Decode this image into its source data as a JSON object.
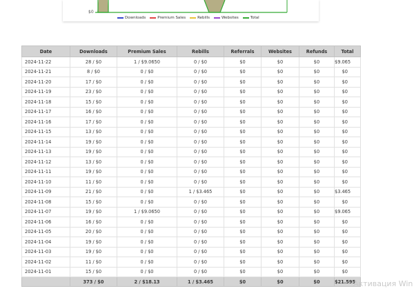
{
  "chart": {
    "y_zero_label": "$0",
    "legend": [
      {
        "label": "Downloads",
        "color": "#3344cc"
      },
      {
        "label": "Premium Sales",
        "color": "#e04444"
      },
      {
        "label": "Rebills",
        "color": "#e8c23a"
      },
      {
        "label": "Websites",
        "color": "#9944cc"
      },
      {
        "label": "Total",
        "color": "#33aa33"
      }
    ]
  },
  "table": {
    "headers": [
      "Date",
      "Downloads",
      "Premium Sales",
      "Rebills",
      "Referrals",
      "Websites",
      "Refunds",
      "Total"
    ],
    "rows": [
      [
        "2024-11-22",
        "28 / $0",
        "1 / $9.0650",
        "0 / $0",
        "$0",
        "$0",
        "$0",
        "$9.065"
      ],
      [
        "2024-11-21",
        "8 / $0",
        "0 / $0",
        "0 / $0",
        "$0",
        "$0",
        "$0",
        "$0"
      ],
      [
        "2024-11-20",
        "17 / $0",
        "0 / $0",
        "0 / $0",
        "$0",
        "$0",
        "$0",
        "$0"
      ],
      [
        "2024-11-19",
        "23 / $0",
        "0 / $0",
        "0 / $0",
        "$0",
        "$0",
        "$0",
        "$0"
      ],
      [
        "2024-11-18",
        "15 / $0",
        "0 / $0",
        "0 / $0",
        "$0",
        "$0",
        "$0",
        "$0"
      ],
      [
        "2024-11-17",
        "16 / $0",
        "0 / $0",
        "0 / $0",
        "$0",
        "$0",
        "$0",
        "$0"
      ],
      [
        "2024-11-16",
        "17 / $0",
        "0 / $0",
        "0 / $0",
        "$0",
        "$0",
        "$0",
        "$0"
      ],
      [
        "2024-11-15",
        "13 / $0",
        "0 / $0",
        "0 / $0",
        "$0",
        "$0",
        "$0",
        "$0"
      ],
      [
        "2024-11-14",
        "19 / $0",
        "0 / $0",
        "0 / $0",
        "$0",
        "$0",
        "$0",
        "$0"
      ],
      [
        "2024-11-13",
        "19 / $0",
        "0 / $0",
        "0 / $0",
        "$0",
        "$0",
        "$0",
        "$0"
      ],
      [
        "2024-11-12",
        "13 / $0",
        "0 / $0",
        "0 / $0",
        "$0",
        "$0",
        "$0",
        "$0"
      ],
      [
        "2024-11-11",
        "19 / $0",
        "0 / $0",
        "0 / $0",
        "$0",
        "$0",
        "$0",
        "$0"
      ],
      [
        "2024-11-10",
        "11 / $0",
        "0 / $0",
        "0 / $0",
        "$0",
        "$0",
        "$0",
        "$0"
      ],
      [
        "2024-11-09",
        "21 / $0",
        "0 / $0",
        "1 / $3.465",
        "$0",
        "$0",
        "$0",
        "$3.465"
      ],
      [
        "2024-11-08",
        "15 / $0",
        "0 / $0",
        "0 / $0",
        "$0",
        "$0",
        "$0",
        "$0"
      ],
      [
        "2024-11-07",
        "19 / $0",
        "1 / $9.0650",
        "0 / $0",
        "$0",
        "$0",
        "$0",
        "$9.065"
      ],
      [
        "2024-11-06",
        "16 / $0",
        "0 / $0",
        "0 / $0",
        "$0",
        "$0",
        "$0",
        "$0"
      ],
      [
        "2024-11-05",
        "20 / $0",
        "0 / $0",
        "0 / $0",
        "$0",
        "$0",
        "$0",
        "$0"
      ],
      [
        "2024-11-04",
        "19 / $0",
        "0 / $0",
        "0 / $0",
        "$0",
        "$0",
        "$0",
        "$0"
      ],
      [
        "2024-11-03",
        "19 / $0",
        "0 / $0",
        "0 / $0",
        "$0",
        "$0",
        "$0",
        "$0"
      ],
      [
        "2024-11-02",
        "11 / $0",
        "0 / $0",
        "0 / $0",
        "$0",
        "$0",
        "$0",
        "$0"
      ],
      [
        "2024-11-01",
        "15 / $0",
        "0 / $0",
        "0 / $0",
        "$0",
        "$0",
        "$0",
        "$0"
      ]
    ],
    "footer": [
      "",
      "373 / $0",
      "2 / $18.13",
      "1 / $3.465",
      "$0",
      "$0",
      "$0",
      "$21.595"
    ]
  },
  "watermark": "Активация Win"
}
